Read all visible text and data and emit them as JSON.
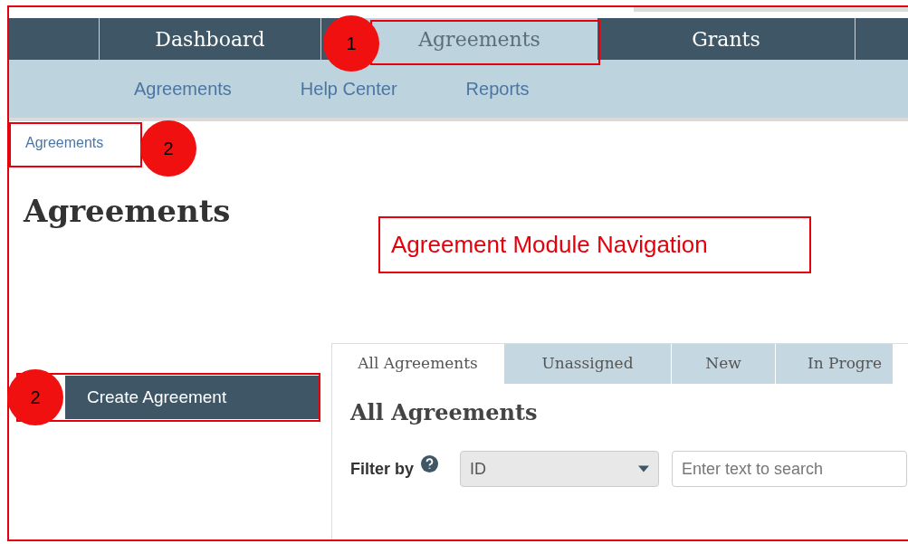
{
  "nav": {
    "tabs": [
      {
        "label": "Dashboard",
        "selected": false
      },
      {
        "label": "Agreements",
        "selected": true
      },
      {
        "label": "Grants",
        "selected": false
      }
    ]
  },
  "subnav": [
    "Agreements",
    "Help Center",
    "Reports"
  ],
  "breadcrumb": "Agreements",
  "heading": "Agreements",
  "create_button": "Create Agreement",
  "list_tabs": [
    {
      "label": "All Agreements",
      "selected": true
    },
    {
      "label": "Unassigned",
      "selected": false
    },
    {
      "label": "New",
      "selected": false
    },
    {
      "label": "In Progre",
      "selected": false
    }
  ],
  "section_title": "All Agreements",
  "filter": {
    "label": "Filter by",
    "select_value": "ID",
    "search_placeholder": "Enter text to search"
  },
  "annotations": {
    "callout": "Agreement Module Navigation",
    "markers": [
      "1",
      "2",
      "2"
    ]
  }
}
